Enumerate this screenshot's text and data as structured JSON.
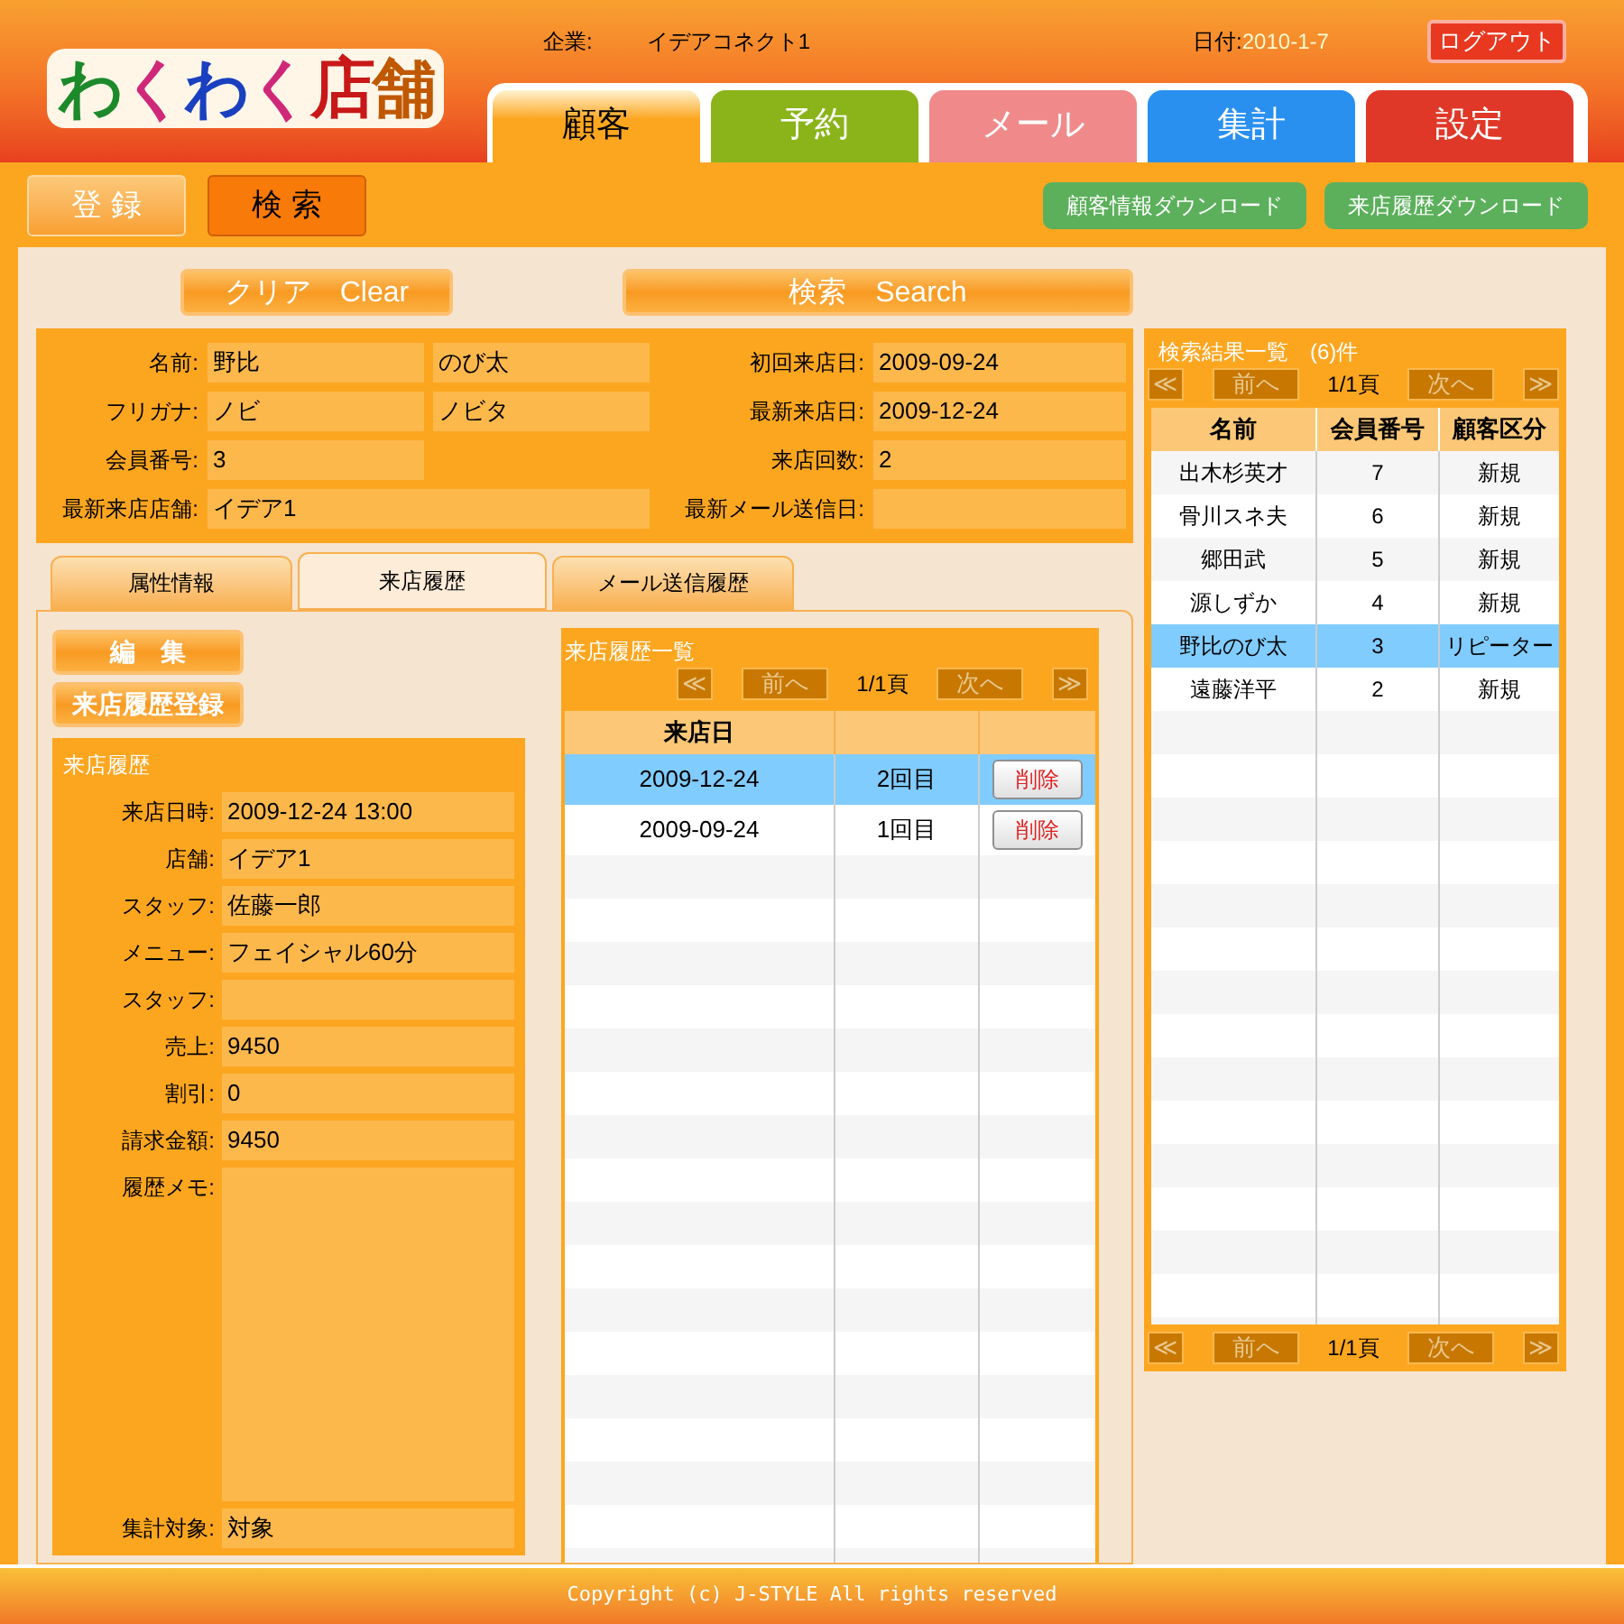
{
  "header": {
    "logo": "わくわく店舗",
    "company_label": "企業:",
    "company": "イデアコネクト1",
    "date_label": "日付:",
    "date": "2010-1-7",
    "logout": "ログアウト"
  },
  "nav_tabs": [
    {
      "label": "顧客",
      "selected": true,
      "color": "#fca620"
    },
    {
      "label": "予約",
      "selected": false,
      "color": "#8ab41a"
    },
    {
      "label": "メール",
      "selected": false,
      "color": "#f08a8a"
    },
    {
      "label": "集計",
      "selected": false,
      "color": "#2a90f0"
    },
    {
      "label": "設定",
      "selected": false,
      "color": "#e03828"
    }
  ],
  "toolbar": {
    "modes": [
      {
        "label": "登 録",
        "selected": false
      },
      {
        "label": "検 索",
        "selected": true
      }
    ],
    "downloads": [
      "顧客情報ダウンロード",
      "来店履歴ダウンロード"
    ]
  },
  "search_buttons": [
    "クリア　Clear",
    "検索　Search"
  ],
  "customer": [
    {
      "label": "名前:",
      "values": [
        "野比",
        "のび太"
      ],
      "wide": false,
      "right_label": "初回来店日:",
      "right_value": "2009-09-24"
    },
    {
      "label": "フリガナ:",
      "values": [
        "ノビ",
        "ノビタ"
      ],
      "wide": false,
      "right_label": "最新来店日:",
      "right_value": "2009-12-24"
    },
    {
      "label": "会員番号:",
      "values": [
        "3"
      ],
      "wide": false,
      "right_label": "来店回数:",
      "right_value": "2"
    },
    {
      "label": "最新来店店舗:",
      "values": [
        "イデア1"
      ],
      "wide": true,
      "right_label": "最新メール送信日:"
    }
  ],
  "detail_tabs": [
    {
      "label": "属性情報",
      "selected": false
    },
    {
      "label": "来店履歴",
      "selected": true
    },
    {
      "label": "メール送信履歴",
      "selected": false
    }
  ],
  "visit_actions": [
    "編　集",
    "来店履歴登録"
  ],
  "visit_detail": {
    "title": "来店履歴",
    "fields": [
      {
        "label": "来店日時:",
        "value": "2009-12-24 13:00",
        "kind": "line"
      },
      {
        "label": "店舗:",
        "value": "イデア1",
        "kind": "line"
      },
      {
        "label": "スタッフ:",
        "value": "佐藤一郎",
        "kind": "line"
      },
      {
        "label": "メニュー:",
        "value": "フェイシャル60分",
        "kind": "line"
      },
      {
        "label": "スタッフ:",
        "kind": "line"
      },
      {
        "label": "売上:",
        "value": "9450",
        "kind": "line"
      },
      {
        "label": "割引:",
        "value": "0",
        "kind": "line"
      },
      {
        "label": "請求金額:",
        "value": "9450",
        "kind": "line"
      },
      {
        "label": "履歴メモ:",
        "kind": "memo"
      },
      {
        "label": "集計対象:",
        "value": "対象",
        "kind": "line"
      }
    ]
  },
  "visit_list": {
    "title": "来店履歴一覧",
    "pager": {
      "first": "≪",
      "prev": "前へ",
      "page": "1/1頁",
      "next": "次へ",
      "last": "≫"
    },
    "columns": [
      "来店日"
    ],
    "rows": [
      {
        "date": "2009-12-24",
        "count": "2回目",
        "action": "削除",
        "selected": true
      },
      {
        "date": "2009-09-24",
        "count": "1回目",
        "action": "削除",
        "selected": false
      }
    ]
  },
  "results": {
    "title": "検索結果一覧",
    "count": "(6)件",
    "pager_top": {
      "first": "≪",
      "prev": "前へ",
      "page": "1/1頁",
      "next": "次へ",
      "last": "≫"
    },
    "columns": [
      "名前",
      "会員番号",
      "顧客区分"
    ],
    "rows": [
      {
        "name": "出木杉英才",
        "number": "7",
        "type": "新規",
        "selected": false
      },
      {
        "name": "骨川スネ夫",
        "number": "6",
        "type": "新規",
        "selected": false
      },
      {
        "name": "郷田武",
        "number": "5",
        "type": "新規",
        "selected": false
      },
      {
        "name": "源しずか",
        "number": "4",
        "type": "新規",
        "selected": false
      },
      {
        "name": "野比のび太",
        "number": "3",
        "type": "リピーター",
        "selected": true
      },
      {
        "name": "遠藤洋平",
        "number": "2",
        "type": "新規",
        "selected": false
      }
    ],
    "pager_bottom": {
      "first": "≪",
      "prev": "前へ",
      "page": "1/1頁",
      "next": "次へ",
      "last": "≫"
    }
  },
  "footer": "Copyright (c) J-STYLE All rights reserved"
}
